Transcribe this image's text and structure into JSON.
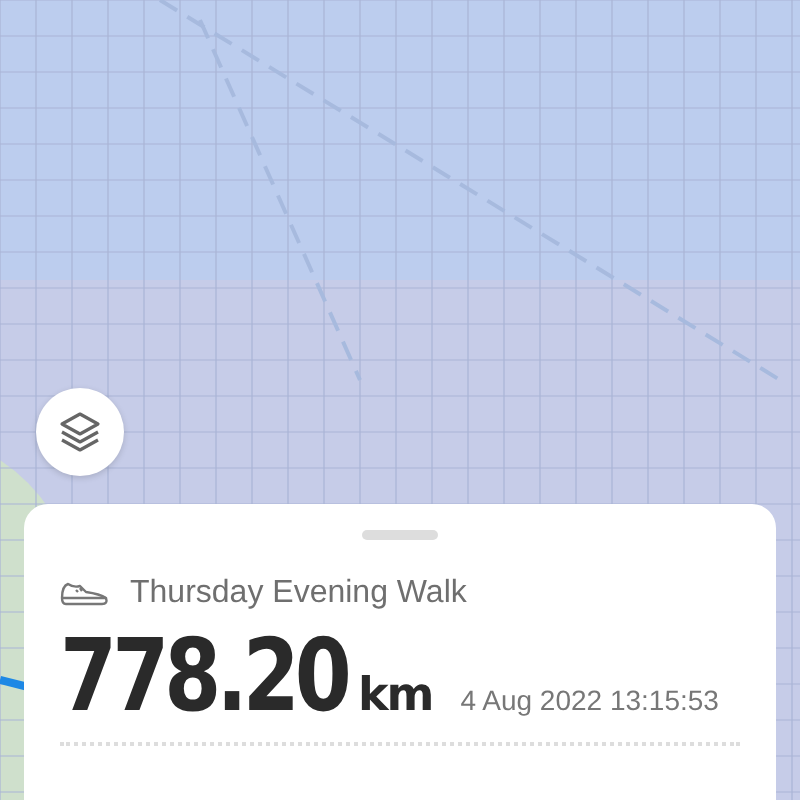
{
  "activity": {
    "title": "Thursday Evening Walk",
    "distance": "778.20",
    "unit": "km",
    "timestamp": "4 Aug 2022 13:15:53"
  }
}
